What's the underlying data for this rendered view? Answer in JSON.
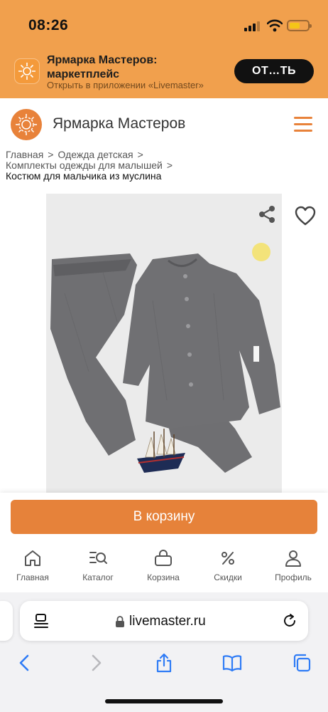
{
  "status_bar": {
    "time": "08:26",
    "battery_color": "#F5C518"
  },
  "app_banner": {
    "title": "Ярмарка Мастеров: маркетплейс",
    "subtitle": "Открыть в приложении «Livemaster»",
    "open_button": "ОТ…ТЬ",
    "background": "#F1A04D"
  },
  "header": {
    "brand": "Ярмарка Мастеров",
    "logo_icon": "sun-logo-icon",
    "menu_icon": "hamburger-menu-icon",
    "accent": "#E8823A"
  },
  "breadcrumbs": {
    "items": [
      "Главная",
      "Одежда детская",
      "Комплекты одежды для малышей"
    ],
    "current": "Костюм для мальчика из муслина"
  },
  "product": {
    "image_alt": "product-photo",
    "share_icon": "share-icon",
    "favorite_icon": "heart-icon"
  },
  "cart": {
    "label": "В корзину",
    "color": "#E6823A"
  },
  "site_nav": {
    "items": [
      {
        "label": "Главная",
        "icon": "home-icon"
      },
      {
        "label": "Каталог",
        "icon": "catalog-search-icon"
      },
      {
        "label": "Корзина",
        "icon": "basket-icon"
      },
      {
        "label": "Скидки",
        "icon": "percent-icon"
      },
      {
        "label": "Профиль",
        "icon": "profile-icon"
      }
    ]
  },
  "browser": {
    "url": "livemaster.ru"
  }
}
